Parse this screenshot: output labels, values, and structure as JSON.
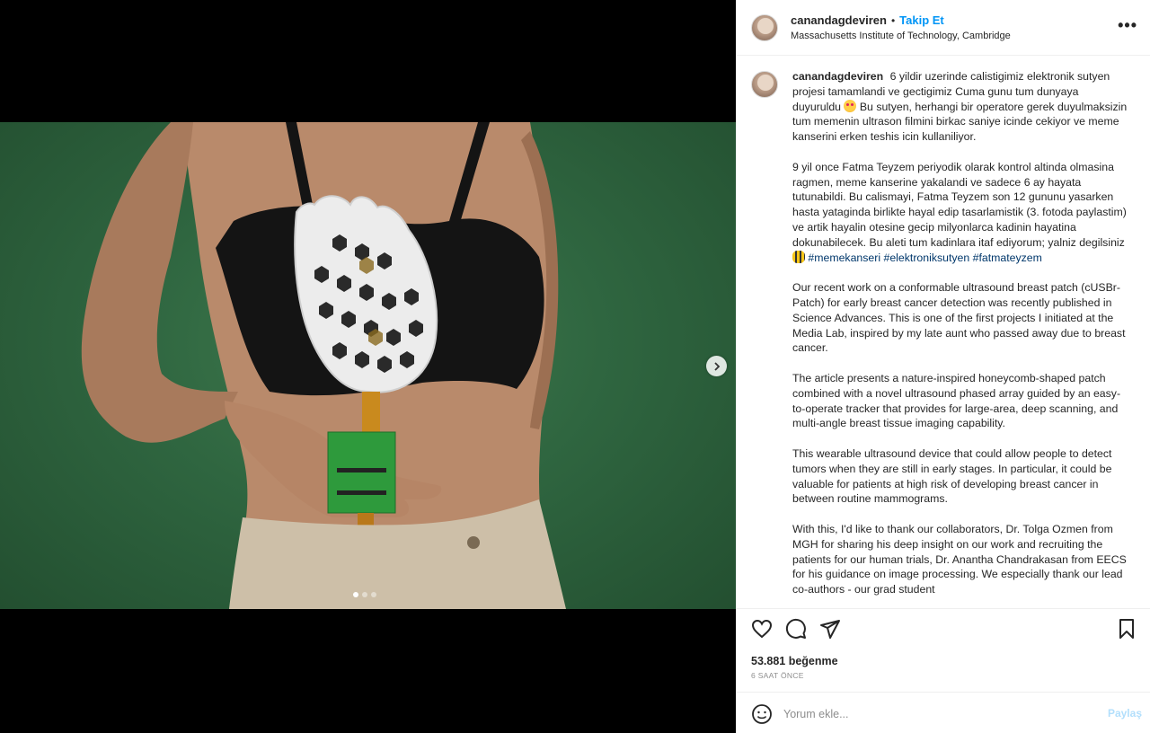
{
  "post": {
    "username": "canandagdeviren",
    "separator": "•",
    "follow_label": "Takip Et",
    "location": "Massachusetts Institute of Technology, Cambridge",
    "more_label": "•••"
  },
  "caption": {
    "username": "canandagdeviren",
    "p1_part1": "6 yildir uzerinde calistigimiz elektronik sutyen projesi tamamlandi ve gectigimiz Cuma gunu tum dunyaya duyuruldu",
    "p1_part2": "Bu sutyen, herhangi bir operatore gerek duyulmaksizin tum memenin ultrason filmini birkac saniye icinde cekiyor ve meme kanserini erken teshis icin kullaniliyor.",
    "p2_text": "9 yil once Fatma Teyzem periyodik olarak kontrol altinda olmasina ragmen, meme kanserine yakalandi ve sadece 6 ay hayata tutunabildi. Bu calismayi, Fatma Teyzem son 12 gununu yasarken hasta yataginda birlikte hayal edip tasarlamistik (3. fotoda paylastim) ve artik hayalin otesine gecip milyonlarca kadinin hayatina dokunabilecek. Bu aleti tum kadinlara itaf ediyorum; yalniz degilsiniz",
    "hashtags": [
      "#memekanseri",
      "#elektroniksutyen",
      "#fatmateyzem"
    ],
    "p3": "Our recent work on a conformable ultrasound breast patch (cUSBr-Patch) for early breast cancer detection was recently published in Science Advances. This is one of the first projects I initiated at the Media Lab, inspired by my late aunt who passed away due to breast cancer.",
    "p4": "The article presents a nature-inspired honeycomb-shaped patch combined with a novel ultrasound phased array guided by an easy-to-operate tracker that provides for large-area, deep scanning, and multi-angle breast tissue imaging capability.",
    "p5": "This wearable ultrasound device that could allow people to detect tumors when they are still in early stages. In particular, it could be valuable for patients at high risk of developing breast cancer in between routine mammograms.",
    "p6": "With this, I'd like to thank our collaborators, Dr. Tolga Ozmen from MGH for sharing his deep insight on our work and recruiting the patients for our human trials, Dr. Anantha Chandrakasan from EECS for his guidance on image processing. We especially thank our lead co-authors - our grad student"
  },
  "stats": {
    "likes": "53.881 beğenme",
    "time": "6 SAAT ÖNCE"
  },
  "comment": {
    "placeholder": "Yorum ekle...",
    "post_label": "Paylaş"
  },
  "carousel": {
    "count": 3,
    "active_index": 0
  },
  "colors": {
    "accent": "#0095f6",
    "hashtag": "#00376b",
    "background_green": "#2f6640"
  }
}
